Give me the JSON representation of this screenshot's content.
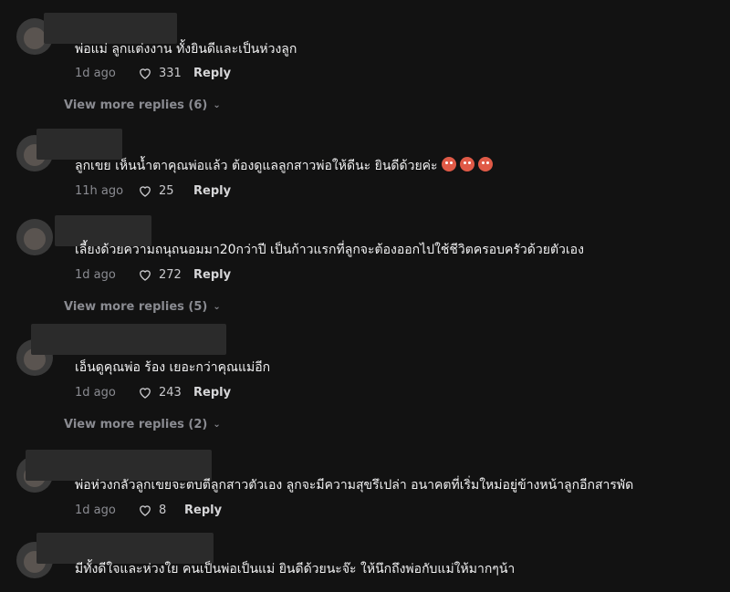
{
  "comments": [
    {
      "text": "พ่อแม่ ลูกแต่งงาน ทั้งยินดีและเป็นห่วงลูก",
      "time": "1d ago",
      "likes": "331",
      "reply": "Reply",
      "view_more": "View more replies (6)"
    },
    {
      "text": "ลูกเขย เห็นน้ำตาคุณพ่อแล้ว ต้องดูแลลูกสาวพ่อให้ดีนะ ยินดีด้วยค่ะ",
      "time": "11h ago",
      "likes": "25",
      "reply": "Reply",
      "emoji_count": 3
    },
    {
      "text": "เลี้ยงด้วยความถนุถนอมมา20กว่าปี เป็นก้าวแรกที่ลูกจะต้องออกไปใช้ชีวิตครอบครัวด้วยตัวเอง",
      "time": "1d ago",
      "likes": "272",
      "reply": "Reply",
      "view_more": "View more replies (5)"
    },
    {
      "text": "เอ็นดูคุณพ่อ ร้อง เยอะกว่าคุณแม่อีก",
      "time": "1d ago",
      "likes": "243",
      "reply": "Reply",
      "view_more": "View more replies (2)"
    },
    {
      "text": "พ่อห่วงกลัวลูกเขยจะตบตีลูกสาวตัวเอง ลูกจะมีความสุขรึเปล่า อนาคตที่เริ่มใหม่อยู่ข้างหน้าลูกอีกสารพัด",
      "time": "1d ago",
      "likes": "8",
      "reply": "Reply"
    },
    {
      "text": "มีทั้งดีใจและห่วงใย คนเป็นพ่อเป็นแม่ ยินดีด้วยนะจ๊ะ ให้นึกถึงพ่อกับแม่ให้มากๆน้า"
    }
  ]
}
